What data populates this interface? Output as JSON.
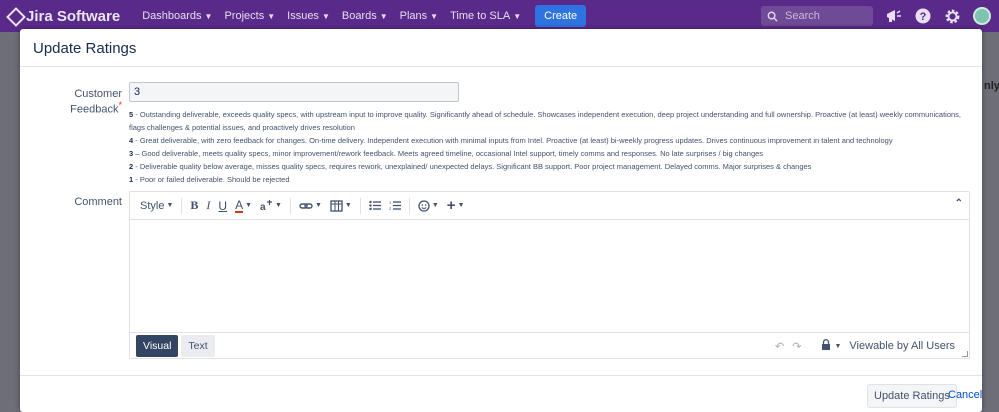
{
  "app": {
    "title": "Jira Software"
  },
  "nav": {
    "items": [
      "Dashboards",
      "Projects",
      "Issues",
      "Boards",
      "Plans",
      "Time to SLA"
    ],
    "create_label": "Create",
    "search_placeholder": "Search",
    "brand_color": "#5a2a8a"
  },
  "background": {
    "right_text": "nly"
  },
  "modal": {
    "title": "Update Ratings",
    "feedback": {
      "label": "Customer Feedback",
      "required_mark": "*",
      "value": "3"
    },
    "scale": [
      {
        "level": "5",
        "text": " - Outstanding deliverable, exceeds quality specs, with upstream input to improve quality. Significantly ahead of schedule. Showcases independent execution, deep project understanding and full ownership. Proactive (at least) weekly communications, flags challenges & potential issues, and proactively drives resolution"
      },
      {
        "level": "4",
        "text": " - Great deliverable, with zero feedback for changes. On-time delivery. Independent execution with minimal inputs from Intel. Proactive (at least) bi-weekly progress updates. Drives continuous improvement in talent and technology"
      },
      {
        "level": "3",
        "text": " – Good deliverable, meets quality specs, minor improvement/rework feedback. Meets agreed timeline, occasional Intel support, timely comms and responses. No late surprises / big changes"
      },
      {
        "level": "2",
        "text": " - Deliverable quality below average, misses quality specs, requires rework, unexplained/ unexpected delays. Significant BB support. Poor project management. Delayed comms. Major surprises & changes"
      },
      {
        "level": "1",
        "text": " - Poor or failed deliverable. Should be rejected"
      }
    ],
    "comment": {
      "label": "Comment",
      "toolbar": {
        "style_label": "Style"
      },
      "modes": {
        "visual": "Visual",
        "text": "Text"
      },
      "visibility": "Viewable by All Users"
    },
    "footer": {
      "update_label": "Update Ratings",
      "cancel_label": "Cancel"
    }
  }
}
